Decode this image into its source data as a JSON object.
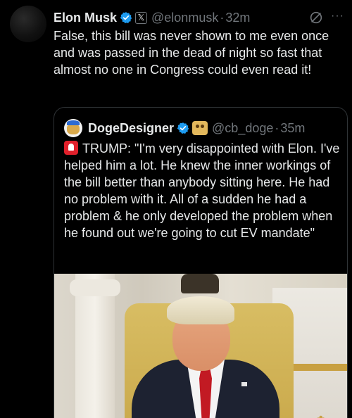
{
  "tweet": {
    "author_name": "Elon Musk",
    "handle": "@elonmusk",
    "separator": "·",
    "time": "32m",
    "text": "False, this bill was never shown to me even once and was passed in the dead of night so fast that almost no one in Congress could even read it!",
    "more_label": "···"
  },
  "quote": {
    "author_name": "DogeDesigner",
    "handle": "@cb_doge",
    "separator": "·",
    "time": "35m",
    "text": "TRUMP: \"I'm very disappointed with Elon. I've helped him a lot. He knew the inner workings of the bill better than anybody sitting here. He had no problem with it. All of a sudden he had a problem & he only developed the problem when he found out we're going to cut EV mandate\""
  },
  "icons": {
    "verified_color": "#1d9bf0",
    "x_badge_glyph": "𝕏"
  }
}
